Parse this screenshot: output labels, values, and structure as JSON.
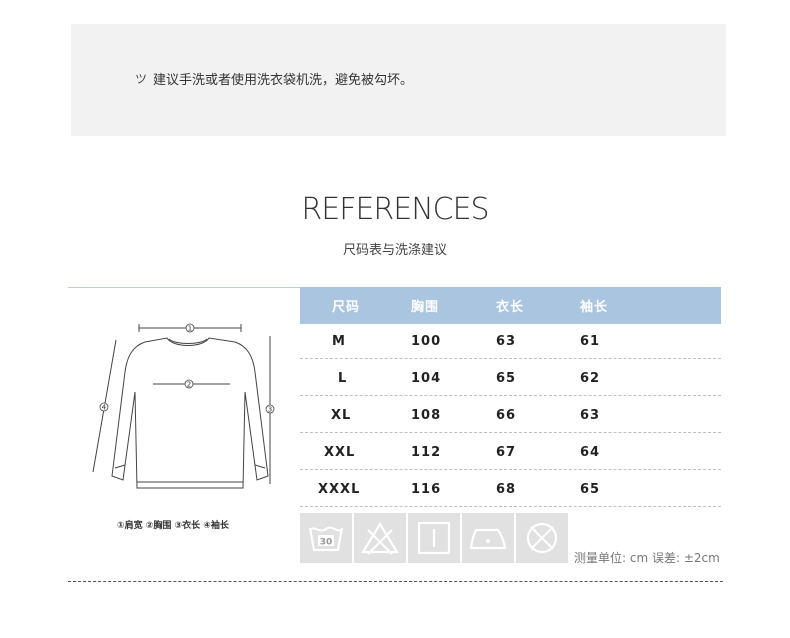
{
  "notice": {
    "icon": "fire-icon",
    "text": "建议手洗或者使用洗衣袋机洗，避免被勾坏。"
  },
  "heading": {
    "title": "REFERENCES",
    "subtitle": "尺码表与洗涤建议"
  },
  "size_table": {
    "headers": [
      "尺码",
      "胸围",
      "衣长",
      "袖长"
    ],
    "rows": [
      [
        "M",
        "100",
        "63",
        "61"
      ],
      [
        "L",
        "104",
        "65",
        "62"
      ],
      [
        "XL",
        "108",
        "66",
        "63"
      ],
      [
        "XXL",
        "112",
        "67",
        "64"
      ],
      [
        "XXXL",
        "116",
        "68",
        "65"
      ]
    ]
  },
  "diagram": {
    "markers": [
      "1",
      "2",
      "3",
      "4"
    ],
    "legend": "①肩宽 ②胸围 ③衣长 ④袖长"
  },
  "care_icons": [
    "wash-30-icon",
    "no-bleach-icon",
    "drip-dry-icon",
    "iron-icon",
    "no-dryclean-icon"
  ],
  "care_icon_labels": {
    "wash_temp": "30"
  },
  "unit_note": "测量单位: cm 误差: ±2cm",
  "colors": {
    "table_header_bg": "#aac5e0",
    "notice_bg": "#f2f2f2",
    "care_icon_bg": "#e1e1e1"
  }
}
